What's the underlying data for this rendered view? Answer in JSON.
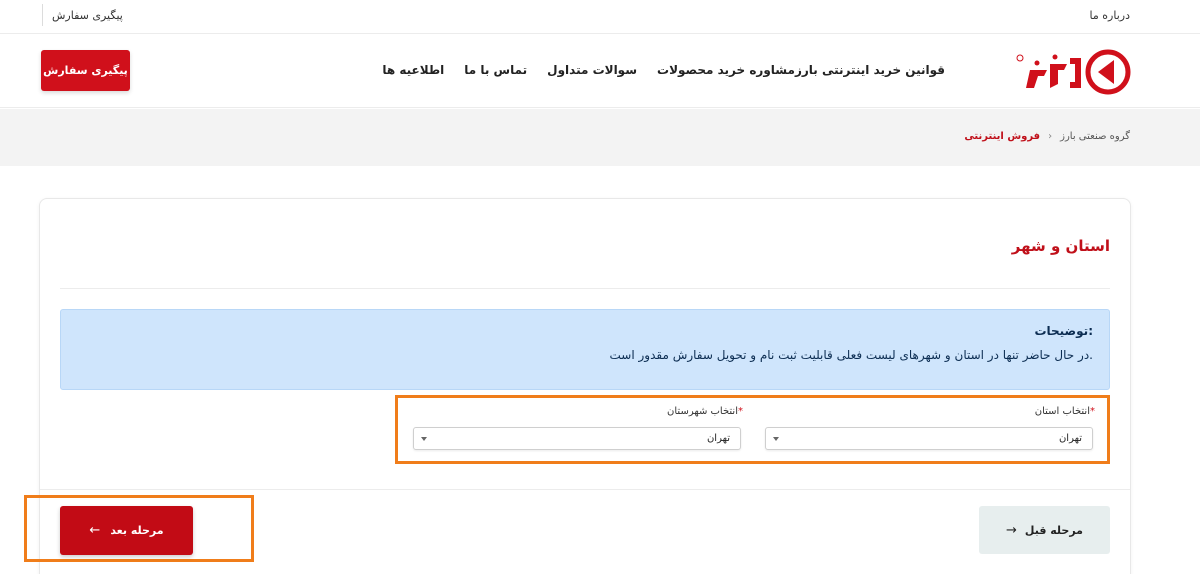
{
  "topbar": {
    "about_label": "درباره ما",
    "track_label": "پیگیری سفارش"
  },
  "header": {
    "logo_alt": "بارز",
    "nav": [
      {
        "label": "قوانین خرید اینترنتی بارز"
      },
      {
        "label": "مشاوره خرید محصولات"
      },
      {
        "label": "سوالات متداول"
      },
      {
        "label": "تماس با ما"
      },
      {
        "label": "اطلاعیه ها"
      }
    ],
    "track_button": "پیگیری سفارش"
  },
  "breadcrumb": {
    "home": "گروه صنعتی بارز",
    "separator": "›",
    "current": "فروش اینترنتی"
  },
  "card": {
    "title": "استان و شهر",
    "info_title": "توضیحات:",
    "info_text": "در حال حاضر تنها در استان و شهرهای لیست فعلی قابلیت ثبت نام و تحویل سفارش مقدور است.",
    "province": {
      "label": "انتخاب استان",
      "required_mark": "*",
      "value": "تهران"
    },
    "city": {
      "label": "انتخاب شهرستان",
      "required_mark": "*",
      "value": "تهران"
    },
    "next_button": "مرحله بعد",
    "prev_button": "مرحله قبل",
    "next_arrow": "←",
    "prev_arrow": "→"
  },
  "colors": {
    "brand_red": "#d0101b",
    "highlight_orange": "#f07d1a",
    "info_bg": "#cfe5fc"
  }
}
